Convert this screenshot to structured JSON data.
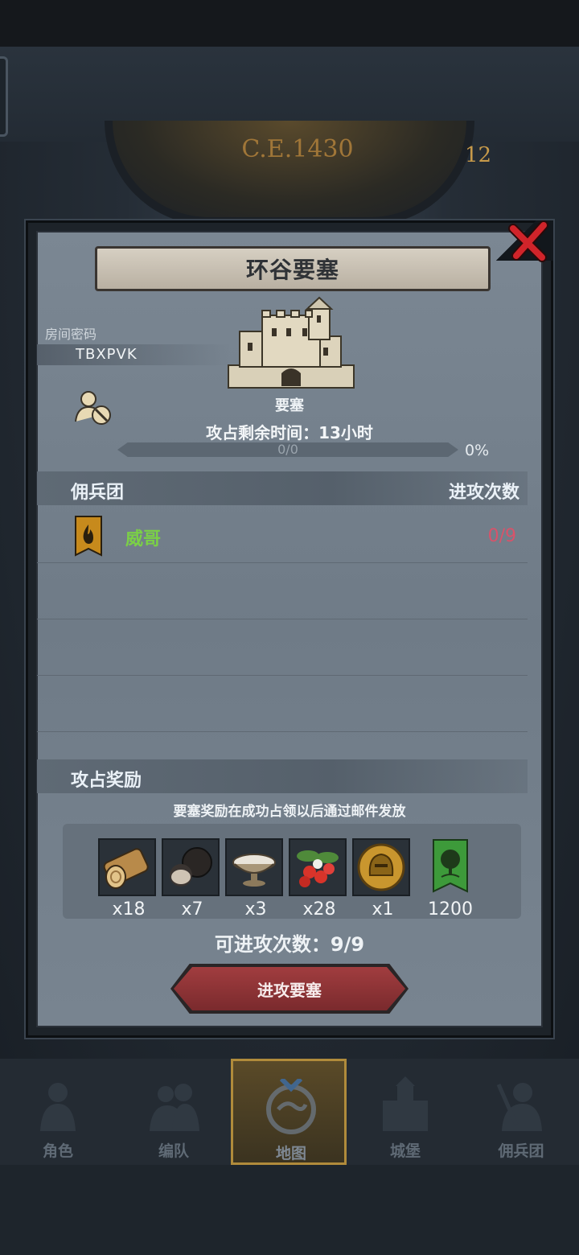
{
  "background": {
    "year": "C.E.1430",
    "dial_number": "12"
  },
  "modal": {
    "title": "环谷要塞",
    "room_label": "房间密码",
    "room_code": "TBXPVK",
    "fort_type": "要塞",
    "time_remaining": "攻占剩余时间：13小时",
    "progress": {
      "text": "0/0",
      "percent_label": "0%",
      "fraction": 0
    },
    "mercenary_header": "佣兵团",
    "attack_count_header": "进攻次数",
    "mercenaries": [
      {
        "name": "威哥",
        "count": "0/9"
      }
    ],
    "reward_header": "攻占奖励",
    "reward_note": "要塞奖励在成功占领以后通过邮件发放",
    "rewards": [
      {
        "icon": "wood-log-icon",
        "qty": "x18"
      },
      {
        "icon": "truffle-icon",
        "qty": "x7"
      },
      {
        "icon": "salt-bowl-icon",
        "qty": "x3"
      },
      {
        "icon": "berries-icon",
        "qty": "x28"
      },
      {
        "icon": "helmet-coin-icon",
        "qty": "x1"
      },
      {
        "icon": "tree-banner-icon",
        "qty": "1200"
      }
    ],
    "attacks_available": "可进攻次数：9/9",
    "attack_button": "进攻要塞"
  },
  "nav": [
    {
      "label": "角色",
      "active": false
    },
    {
      "label": "编队",
      "active": false
    },
    {
      "label": "地图",
      "active": true
    },
    {
      "label": "城堡",
      "active": false
    },
    {
      "label": "佣兵团",
      "active": false
    }
  ],
  "colors": {
    "accent_gold": "#b08b3b",
    "merc_name": "#7bd046",
    "count_red": "#d8536a",
    "button_red": "#a13d3f"
  }
}
